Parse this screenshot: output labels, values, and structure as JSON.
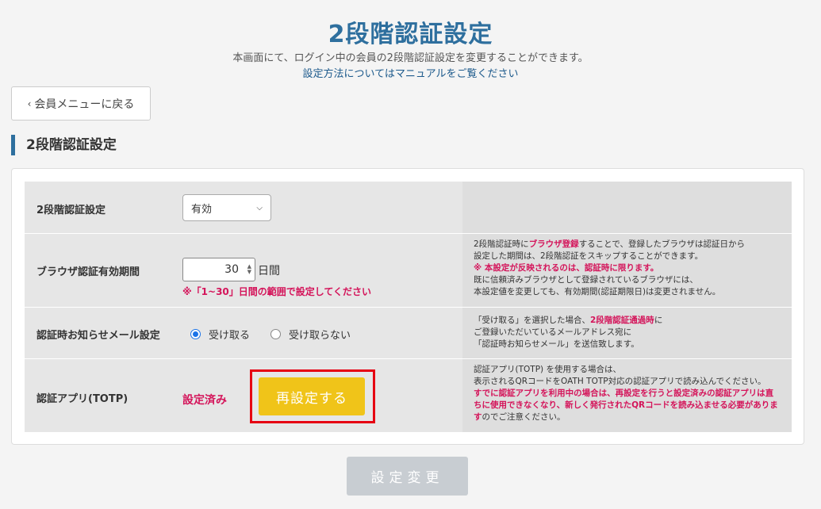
{
  "header": {
    "title": "2段階認証設定",
    "desc_line1": "本画面にて、ログイン中の会員の2段階認証設定を変更することができます。",
    "desc_link": "設定方法についてはマニュアルをご覧ください"
  },
  "nav": {
    "back_chevron": "‹",
    "back_label": "会員メニューに戻る"
  },
  "section": {
    "title": "2段階認証設定"
  },
  "rows": {
    "twofa": {
      "label": "2段階認証設定",
      "select_value": "有効",
      "caret": "⌄"
    },
    "browser": {
      "label": "ブラウザ認証有効期間",
      "input_value": "30",
      "unit": "日間",
      "warning": "※「1~30」日間の範囲で設定してください",
      "help": [
        {
          "t": "2段階認証時に",
          "c": ""
        },
        {
          "t": "ブラウザ登録",
          "c": "pink"
        },
        {
          "t": "することで、登録したブラウザは認証日から",
          "c": ""
        }
      ],
      "help_line2": "設定した期間は、2段階認証をスキップすることができます。",
      "help_line3": "※ 本設定が反映されるのは、認証時に限ります。",
      "help_line4": "既に信頼済みブラウザとして登録されているブラウザには、",
      "help_line5": "本設定値を変更しても、有効期間(認証期限日)は変更されません。"
    },
    "mail": {
      "label": "認証時お知らせメール設定",
      "option_receive": "受け取る",
      "option_decline": "受け取らない",
      "selected": "receive",
      "help_line1_a": "「受け取る」を選択した場合、",
      "help_line1_b": "2段階認証通過時",
      "help_line1_c": "に",
      "help_line2": "ご登録いただいているメールアドレス宛に",
      "help_line3": "「認証時お知らせメール」を送信致します。"
    },
    "totp": {
      "label": "認証アプリ(TOTP)",
      "status": "設定済み",
      "reset_label": "再設定する",
      "help_line1": "認証アプリ(TOTP) を使用する場合は、",
      "help_line2": "表示されるQRコードをOATH TOTP対応の認証アプリで読み込んでください。",
      "help_pink": "すでに認証アプリを利用中の場合は、再設定を行うと設定済みの認証アプリは直ちに使用できなくなり、新しく発行されたQRコードを読み込ませる必要があります",
      "help_tail": "のでご注意ください。"
    }
  },
  "footer": {
    "submit_label": "設定変更"
  },
  "colors": {
    "title_blue": "#2e6f9e",
    "accent_pink": "#d4145a",
    "reset_yellow": "#f0c419",
    "highlight_red": "#e60012",
    "submit_disabled": "#c8cdd2"
  }
}
